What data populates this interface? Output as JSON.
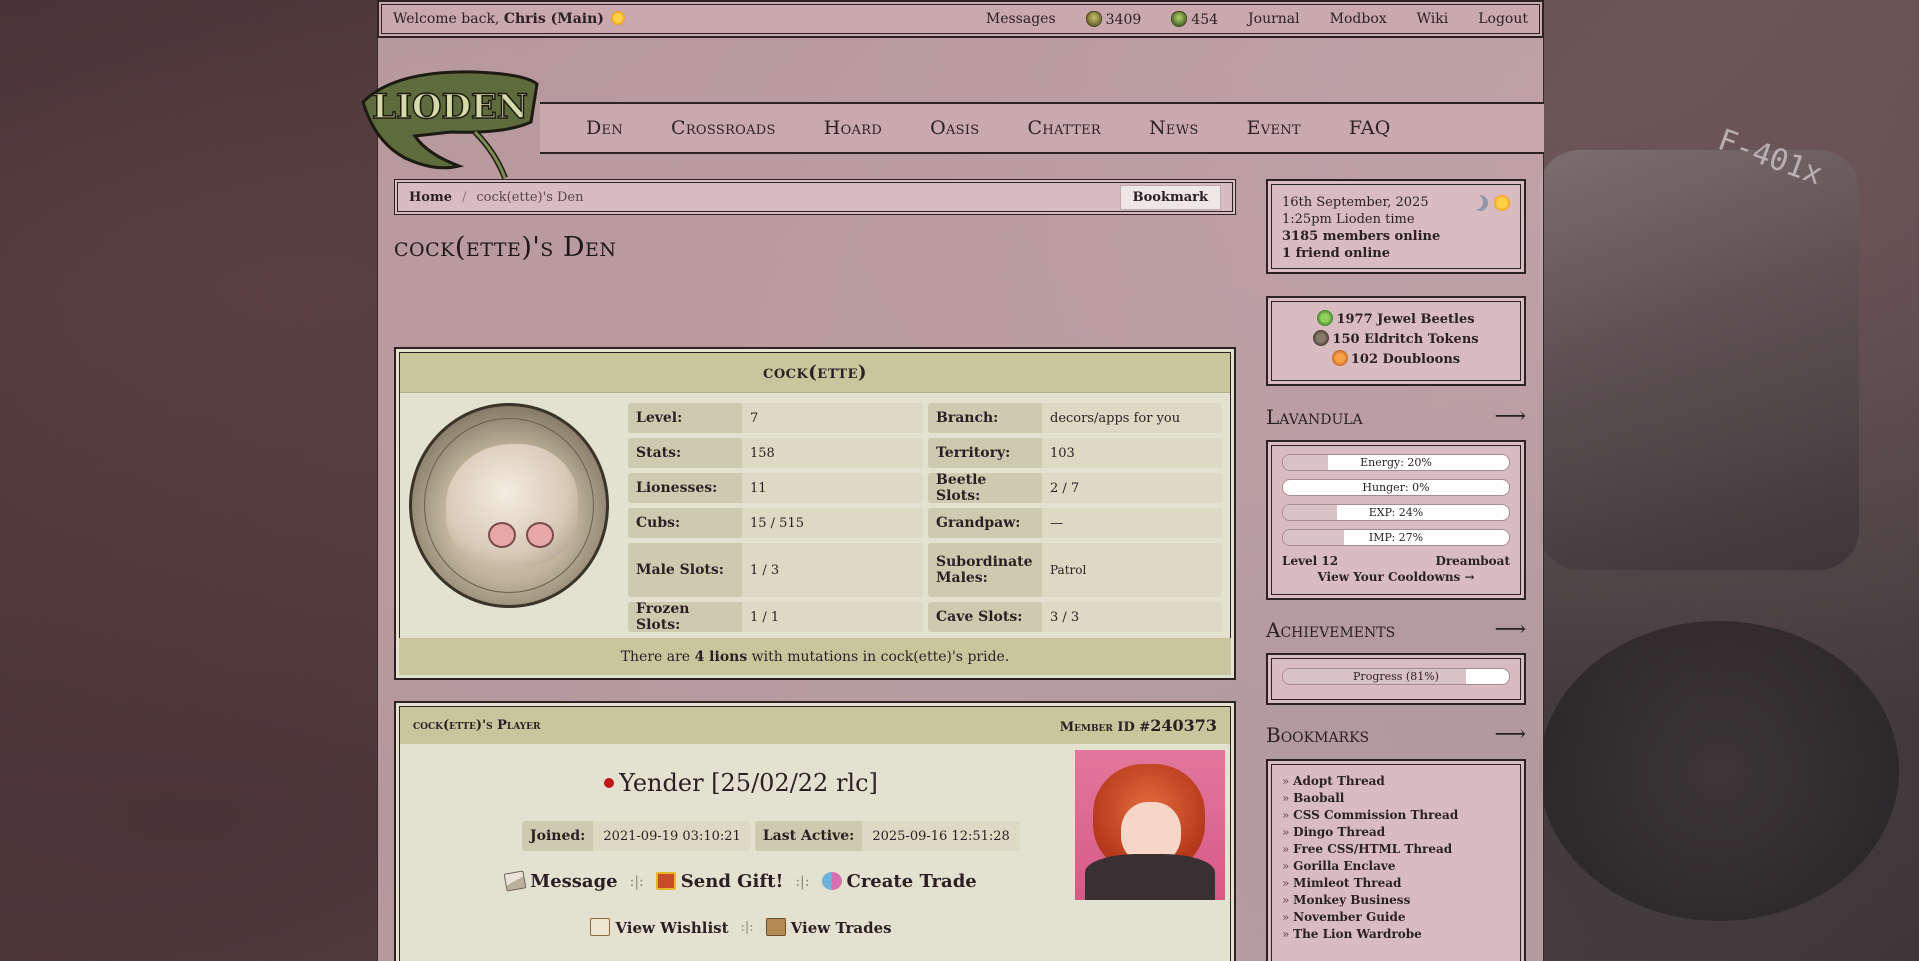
{
  "topbar": {
    "welcome_prefix": "Welcome back, ",
    "user": "Chris (Main)",
    "links": {
      "messages": "Messages",
      "beetles_count": "3409",
      "tokens_count": "454",
      "journal": "Journal",
      "modbox": "Modbox",
      "wiki": "Wiki",
      "logout": "Logout"
    }
  },
  "logo": {
    "text": "LIODEN"
  },
  "nav": [
    "Den",
    "Crossroads",
    "Hoard",
    "Oasis",
    "Chatter",
    "News",
    "Event",
    "FAQ"
  ],
  "breadcrumb": {
    "home": "Home",
    "separator": "/",
    "current": "cock(ette)'s Den",
    "bookmark": "Bookmark"
  },
  "page_title": "cock(ette)'s Den",
  "lion_panel": {
    "name": "cock(ette)",
    "stats": {
      "level_k": "Level:",
      "level_v": "7",
      "branch_k": "Branch:",
      "branch_v": "decors/apps for you",
      "stats_k": "Stats:",
      "stats_v": "158",
      "territory_k": "Territory:",
      "territory_v": "103",
      "lionesses_k": "Lionesses:",
      "lionesses_v": "11",
      "beetle_k": "Beetle Slots:",
      "beetle_v": "2 / 7",
      "cubs_k": "Cubs:",
      "cubs_v": "15 / 515",
      "grandpaw_k": "Grandpaw:",
      "grandpaw_v": "—",
      "male_k": "Male Slots:",
      "male_v": "1 / 3",
      "sub_k": "Subordinate Males:",
      "sub_v": "Patrol",
      "frozen_k": "Frozen Slots:",
      "frozen_v": "1 / 1",
      "cave_k": "Cave Slots:",
      "cave_v": "3 / 3"
    },
    "footer_prefix": "There are ",
    "footer_bold": "4 lions",
    "footer_suffix": " with mutations in cock(ette)'s pride."
  },
  "player_panel": {
    "title": "cock(ette)'s Player",
    "member_label": "Member ID #",
    "member_id": "240373",
    "name": "Yender [25/02/22 rlc]",
    "joined_k": "Joined:",
    "joined_v": "2021-09-19 03:10:21",
    "active_k": "Last Active:",
    "active_v": "2025-09-16 12:51:28",
    "message": "Message",
    "gift": "Send Gift!",
    "trade": "Create Trade",
    "sep": ":|:",
    "wishlist": "View Wishlist",
    "view_trades": "View Trades"
  },
  "sidebar": {
    "date": "16th September, 2025",
    "time": "1:25pm Lioden time",
    "members_online": "3185 members online",
    "friends_online": "1 friend online",
    "jewel_beetles": "1977 Jewel Beetles",
    "eldritch_tokens": "150 Eldritch Tokens",
    "doubloons": "102 Doubloons",
    "lavandula_title": "Lavandula",
    "arrow": "⟶",
    "energy": "Energy: 20%",
    "energy_pct": 20,
    "hunger": "Hunger: 0%",
    "hunger_pct": 0,
    "exp": "EXP: 24%",
    "exp_pct": 24,
    "imp": "IMP: 27%",
    "imp_pct": 27,
    "level": "Level 12",
    "rank": "Dreamboat",
    "cooldowns": "View Your Cooldowns →",
    "achievements_title": "Achievements",
    "progress": "Progress (81%)",
    "progress_pct": 81,
    "bookmarks_title": "Bookmarks",
    "bookmarks": [
      "Adopt Thread",
      "Baoball",
      "CSS Commission Thread",
      "Dingo Thread",
      "Free CSS/HTML Thread",
      "Gorilla Enclave",
      "Mimleot Thread",
      "Monkey Business",
      "November Guide",
      "The Lion Wardrobe"
    ]
  },
  "background": {
    "camera_text": "F-401x"
  }
}
